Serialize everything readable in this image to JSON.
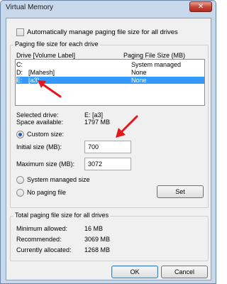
{
  "window": {
    "title": "Virtual Memory",
    "close_glyph": "✕"
  },
  "auto_manage": {
    "label": "Automatically manage paging file size for all drives",
    "checked": false
  },
  "paging_group": {
    "title": "Paging file size for each drive",
    "col_drive": "Drive  [Volume Label]",
    "col_size": "Paging File Size (MB)",
    "rows": [
      {
        "drive": "C:",
        "label": "",
        "size": "System managed",
        "selected": false
      },
      {
        "drive": "D:",
        "label": "[Mahesh]",
        "size": "None",
        "selected": false
      },
      {
        "drive": "E:",
        "label": "[a3]",
        "size": "None",
        "selected": true
      }
    ],
    "selected_drive_label": "Selected drive:",
    "selected_drive_value": "E:  [a3]",
    "space_label": "Space available:",
    "space_value": "1797 MB",
    "custom_size_label": "Custom size:",
    "initial_label": "Initial size (MB):",
    "initial_value": "700",
    "maximum_label": "Maximum size (MB):",
    "maximum_value": "3072",
    "system_managed_label": "System managed size",
    "no_paging_label": "No paging file",
    "set_label": "Set",
    "selected_option": "custom"
  },
  "total_group": {
    "title": "Total paging file size for all drives",
    "min_label": "Minimum allowed:",
    "min_value": "16 MB",
    "rec_label": "Recommended:",
    "rec_value": "3069 MB",
    "cur_label": "Currently allocated:",
    "cur_value": "1268 MB"
  },
  "buttons": {
    "ok": "OK",
    "cancel": "Cancel"
  },
  "colors": {
    "annotation": "#e2161b",
    "selection": "#3399ff"
  }
}
